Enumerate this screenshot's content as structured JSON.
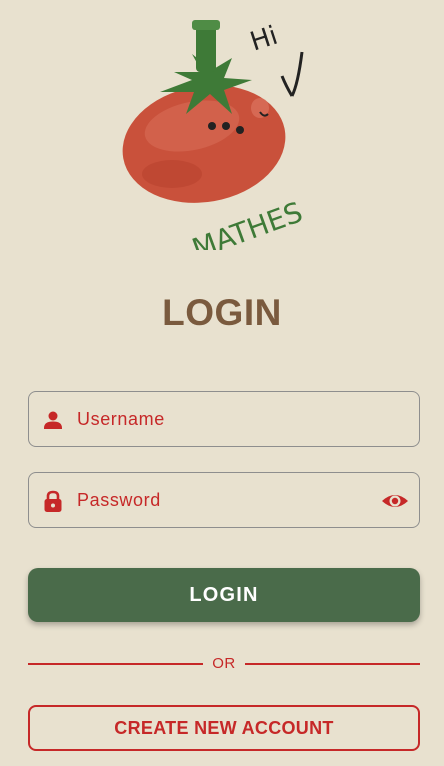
{
  "logo": {
    "greeting_text": "Hi",
    "brand_text": "MATHES",
    "colors": {
      "tomato": "#C9513B",
      "leaf": "#3E7A37",
      "ink": "#222222"
    }
  },
  "title": "LOGIN",
  "username_field": {
    "placeholder": "Username",
    "icon": "person-icon"
  },
  "password_field": {
    "placeholder": "Password",
    "icon": "lock-icon",
    "toggle_icon": "eye-icon"
  },
  "login_button": {
    "label": "LOGIN"
  },
  "divider": {
    "text": "OR"
  },
  "create_account_button": {
    "label": "CREATE NEW ACCOUNT"
  },
  "colors": {
    "background": "#E8E1CF",
    "accent_red": "#C62828",
    "primary_green": "#4A6B4A",
    "title_brown": "#7A5A3E"
  }
}
